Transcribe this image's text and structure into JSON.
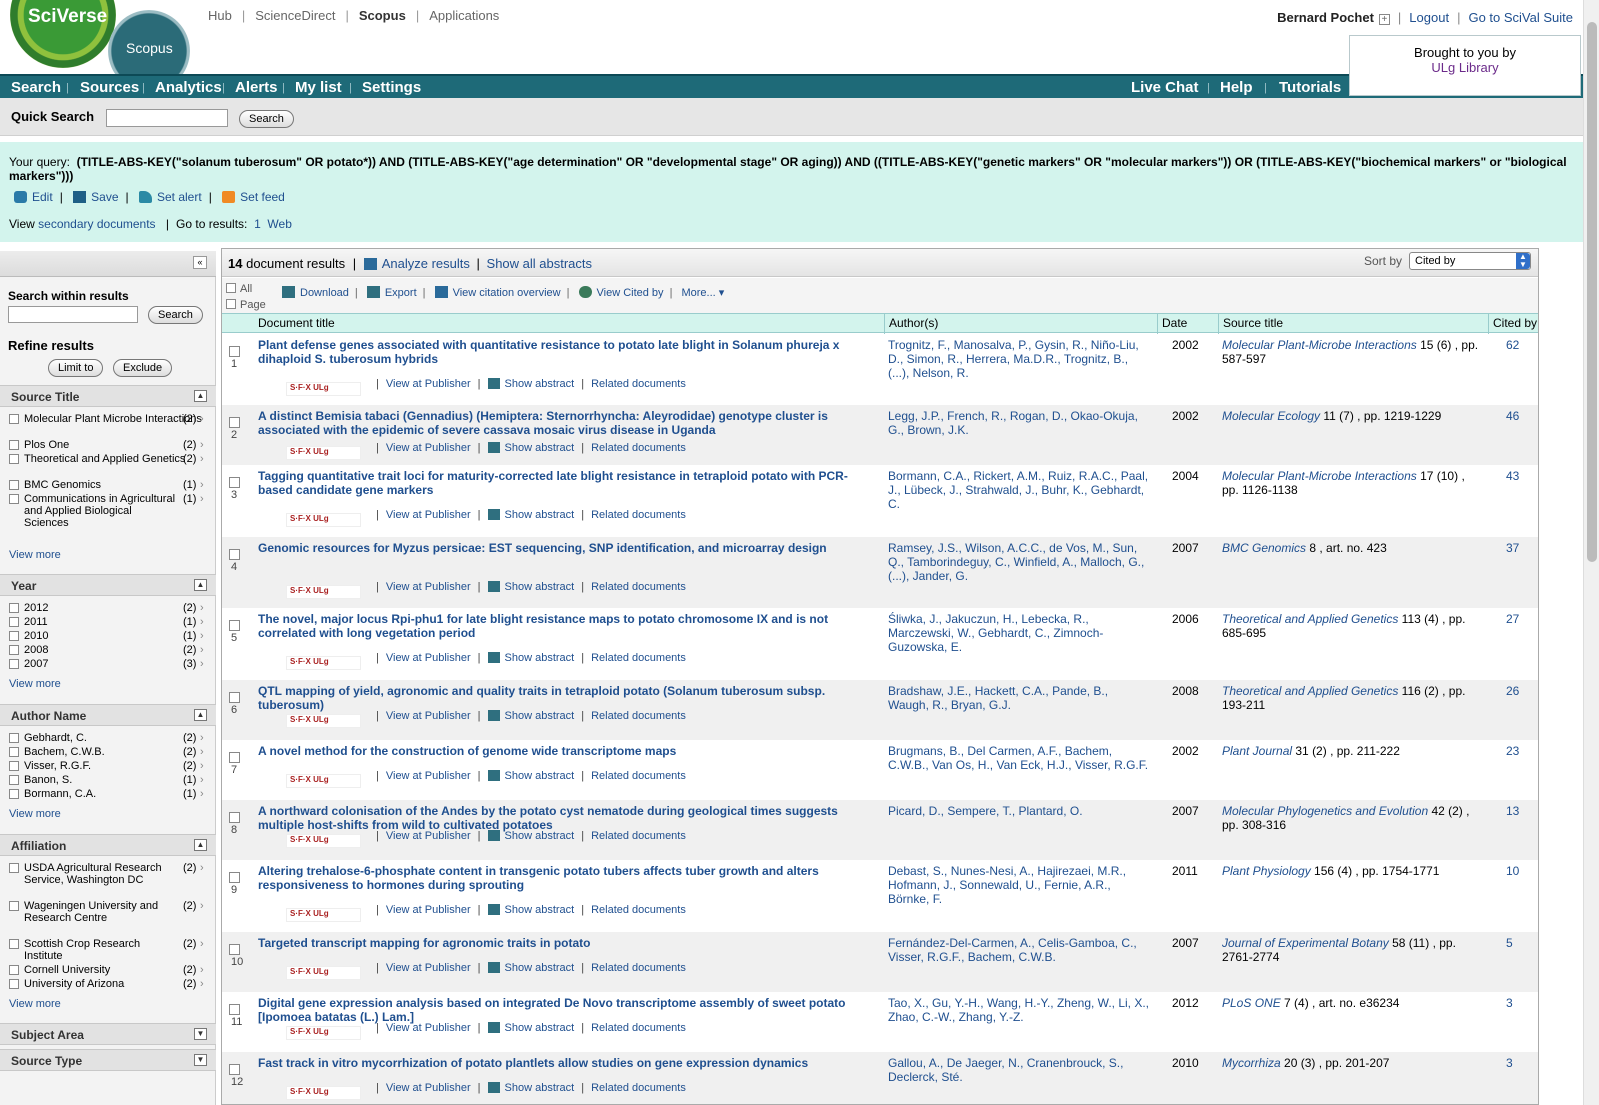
{
  "logo": {
    "sciverse": "SciVerse",
    "scopus": "Scopus"
  },
  "topnav": [
    "Hub",
    "ScienceDirect",
    "Scopus",
    "Applications"
  ],
  "user": {
    "name": "Bernard Pochet",
    "logout": "Logout",
    "scival": "Go to SciVal Suite"
  },
  "brought": {
    "line1": "Brought to you by",
    "library": "ULg Library"
  },
  "mainnav": {
    "left": [
      "Search",
      "Sources",
      "Analytics",
      "Alerts",
      "My list",
      "Settings"
    ],
    "right": [
      "Live Chat",
      "Help",
      "Tutorials"
    ]
  },
  "quick_search": {
    "label": "Quick Search",
    "button": "Search",
    "value": ""
  },
  "query": {
    "label": "Your query:",
    "text": "(TITLE-ABS-KEY(\"solanum tuberosum\" OR potato*)) AND (TITLE-ABS-KEY(\"age determination\" OR \"developmental stage\" OR aging)) AND ((TITLE-ABS-KEY(\"genetic markers\" OR \"molecular markers\")) OR (TITLE-ABS-KEY(\"biochemical markers\"  or \"biological markers\")))",
    "actions": [
      "Edit",
      "Save",
      "Set alert",
      "Set feed"
    ],
    "view_prefix": "View",
    "secondary": "secondary documents",
    "goto": "Go to results:",
    "goto_1": "1",
    "goto_web": "Web"
  },
  "sidebar": {
    "search_within": "Search within results",
    "search_button": "Search",
    "refine": "Refine results",
    "limit": "Limit to",
    "exclude": "Exclude",
    "view_more": "View more",
    "facets": {
      "source_title": {
        "title": "Source Title",
        "items": [
          {
            "label": "Molecular Plant Microbe Interactions",
            "count": "(2)"
          },
          {
            "label": "Plos One",
            "count": "(2)"
          },
          {
            "label": "Theoretical and Applied Genetics",
            "count": "(2)"
          },
          {
            "label": "BMC Genomics",
            "count": "(1)"
          },
          {
            "label": "Communications in Agricultural and Applied Biological Sciences",
            "count": "(1)"
          }
        ]
      },
      "year": {
        "title": "Year",
        "items": [
          {
            "label": "2012",
            "count": "(2)"
          },
          {
            "label": "2011",
            "count": "(1)"
          },
          {
            "label": "2010",
            "count": "(1)"
          },
          {
            "label": "2008",
            "count": "(2)"
          },
          {
            "label": "2007",
            "count": "(3)"
          }
        ]
      },
      "author": {
        "title": "Author Name",
        "items": [
          {
            "label": "Gebhardt, C.",
            "count": "(2)"
          },
          {
            "label": "Bachem, C.W.B.",
            "count": "(2)"
          },
          {
            "label": "Visser, R.G.F.",
            "count": "(2)"
          },
          {
            "label": "Banon, S.",
            "count": "(1)"
          },
          {
            "label": "Bormann, C.A.",
            "count": "(1)"
          }
        ]
      },
      "affiliation": {
        "title": "Affiliation",
        "items": [
          {
            "label": "USDA Agricultural Research Service, Washington DC",
            "count": "(2)"
          },
          {
            "label": "Wageningen University and Research Centre",
            "count": "(2)"
          },
          {
            "label": "Scottish Crop Research Institute",
            "count": "(2)"
          },
          {
            "label": "Cornell University",
            "count": "(2)"
          },
          {
            "label": "University of Arizona",
            "count": "(2)"
          }
        ]
      },
      "subject_area": {
        "title": "Subject Area"
      },
      "source_type": {
        "title": "Source Type"
      }
    }
  },
  "results": {
    "count": "14",
    "count_suffix": "document results",
    "analyze": "Analyze results",
    "show_all": "Show all abstracts",
    "sort_label": "Sort by",
    "sort_value": "Cited by",
    "select_all": "All",
    "select_page": "Page",
    "tools": [
      "Download",
      "Export",
      "View citation overview",
      "View Cited by",
      "More..."
    ],
    "columns": [
      "Document title",
      "Author(s)",
      "Date",
      "Source title",
      "Cited by"
    ],
    "link_labels": {
      "publisher": "View at Publisher",
      "abstract": "Show abstract",
      "related": "Related documents",
      "sfx": "S·F·X ULg"
    },
    "rows": [
      {
        "num": "1",
        "title": "Plant defense genes associated with quantitative resistance to potato late blight in Solanum phureja x dihaploid S. tuberosum hybrids",
        "authors": "Trognitz, F., Manosalva, P., Gysin, R., Niño-Liu, D., Simon, R., Herrera, Ma.D.R., Trognitz, B., (...), Nelson, R.",
        "date": "2002",
        "source": "Molecular Plant-Microbe Interactions",
        "src_detail": " 15 (6) , pp. 587-597",
        "cited": "62"
      },
      {
        "num": "2",
        "title": "A distinct Bemisia tabaci (Gennadius) (Hemiptera: Sternorrhyncha: Aleyrodidae) genotype cluster is associated with the epidemic of severe cassava mosaic virus disease in Uganda",
        "authors": "Legg, J.P., French, R., Rogan, D., Okao-Okuja, G., Brown, J.K.",
        "date": "2002",
        "source": "Molecular Ecology",
        "src_detail": " 11 (7) , pp. 1219-1229",
        "cited": "46"
      },
      {
        "num": "3",
        "title": "Tagging quantitative trait loci for maturity-corrected late blight resistance in tetraploid potato with PCR-based candidate gene markers",
        "authors": "Bormann, C.A., Rickert, A.M., Ruiz, R.A.C., Paal, J., Lübeck, J., Strahwald, J., Buhr, K., Gebhardt, C.",
        "date": "2004",
        "source": "Molecular Plant-Microbe Interactions",
        "src_detail": " 17 (10) , pp. 1126-1138",
        "cited": "43"
      },
      {
        "num": "4",
        "title": "Genomic resources for Myzus persicae: EST sequencing, SNP identification, and microarray design",
        "authors": "Ramsey, J.S., Wilson, A.C.C., de Vos, M., Sun, Q., Tamborindeguy, C., Winfield, A., Malloch, G., (...), Jander, G.",
        "date": "2007",
        "source": "BMC Genomics",
        "src_detail": " 8 , art. no. 423",
        "cited": "37"
      },
      {
        "num": "5",
        "title": "The novel, major locus Rpi-phu1 for late blight resistance maps to potato chromosome IX and is not correlated with long vegetation period",
        "authors": "Śliwka, J., Jakuczun, H., Lebecka, R., Marczewski, W., Gebhardt, C., Zimnoch-Guzowska, E.",
        "date": "2006",
        "source": "Theoretical and Applied Genetics",
        "src_detail": " 113 (4) , pp. 685-695",
        "cited": "27"
      },
      {
        "num": "6",
        "title": "QTL mapping of yield, agronomic and quality traits in tetraploid potato (Solanum tuberosum subsp. tuberosum)",
        "authors": "Bradshaw, J.E., Hackett, C.A., Pande, B., Waugh, R., Bryan, G.J.",
        "date": "2008",
        "source": "Theoretical and Applied Genetics",
        "src_detail": " 116 (2) , pp. 193-211",
        "cited": "26"
      },
      {
        "num": "7",
        "title": "A novel method for the construction of genome wide transcriptome maps",
        "authors": "Brugmans, B., Del Carmen, A.F., Bachem, C.W.B., Van Os, H., Van Eck, H.J., Visser, R.G.F.",
        "date": "2002",
        "source": "Plant Journal",
        "src_detail": " 31 (2) , pp. 211-222",
        "cited": "23"
      },
      {
        "num": "8",
        "title": "A northward colonisation of the Andes by the potato cyst nematode during geological times suggests multiple host-shifts from wild to cultivated potatoes",
        "authors": "Picard, D., Sempere, T., Plantard, O.",
        "date": "2007",
        "source": "Molecular Phylogenetics and Evolution",
        "src_detail": " 42 (2) , pp. 308-316",
        "cited": "13"
      },
      {
        "num": "9",
        "title": "Altering trehalose-6-phosphate content in transgenic potato tubers affects tuber growth and alters responsiveness to hormones during sprouting",
        "authors": "Debast, S., Nunes-Nesi, A., Hajirezaei, M.R., Hofmann, J., Sonnewald, U., Fernie, A.R., Börnke, F.",
        "date": "2011",
        "source": "Plant Physiology",
        "src_detail": " 156 (4) , pp. 1754-1771",
        "cited": "10"
      },
      {
        "num": "10",
        "title": "Targeted transcript mapping for agronomic traits in potato",
        "authors": "Fernández-Del-Carmen, A., Celis-Gamboa, C., Visser, R.G.F., Bachem, C.W.B.",
        "date": "2007",
        "source": "Journal of Experimental Botany",
        "src_detail": " 58 (11) , pp. 2761-2774",
        "cited": "5"
      },
      {
        "num": "11",
        "title": "Digital gene expression analysis based on integrated De Novo transcriptome assembly of sweet potato [Ipomoea batatas (L.) Lam.]",
        "authors": "Tao, X., Gu, Y.-H., Wang, H.-Y., Zheng, W., Li, X., Zhao, C.-W., Zhang, Y.-Z.",
        "date": "2012",
        "source": "PLoS ONE",
        "src_detail": " 7 (4) , art. no. e36234",
        "cited": "3"
      },
      {
        "num": "12",
        "title": "Fast track in vitro mycorrhization of potato plantlets allow studies on gene expression dynamics",
        "authors": "Gallou, A., De Jaeger, N., Cranenbrouck, S., Declerck, Sté.",
        "date": "2010",
        "source": "Mycorrhiza",
        "src_detail": " 20 (3) , pp. 201-207",
        "cited": "3"
      }
    ]
  }
}
